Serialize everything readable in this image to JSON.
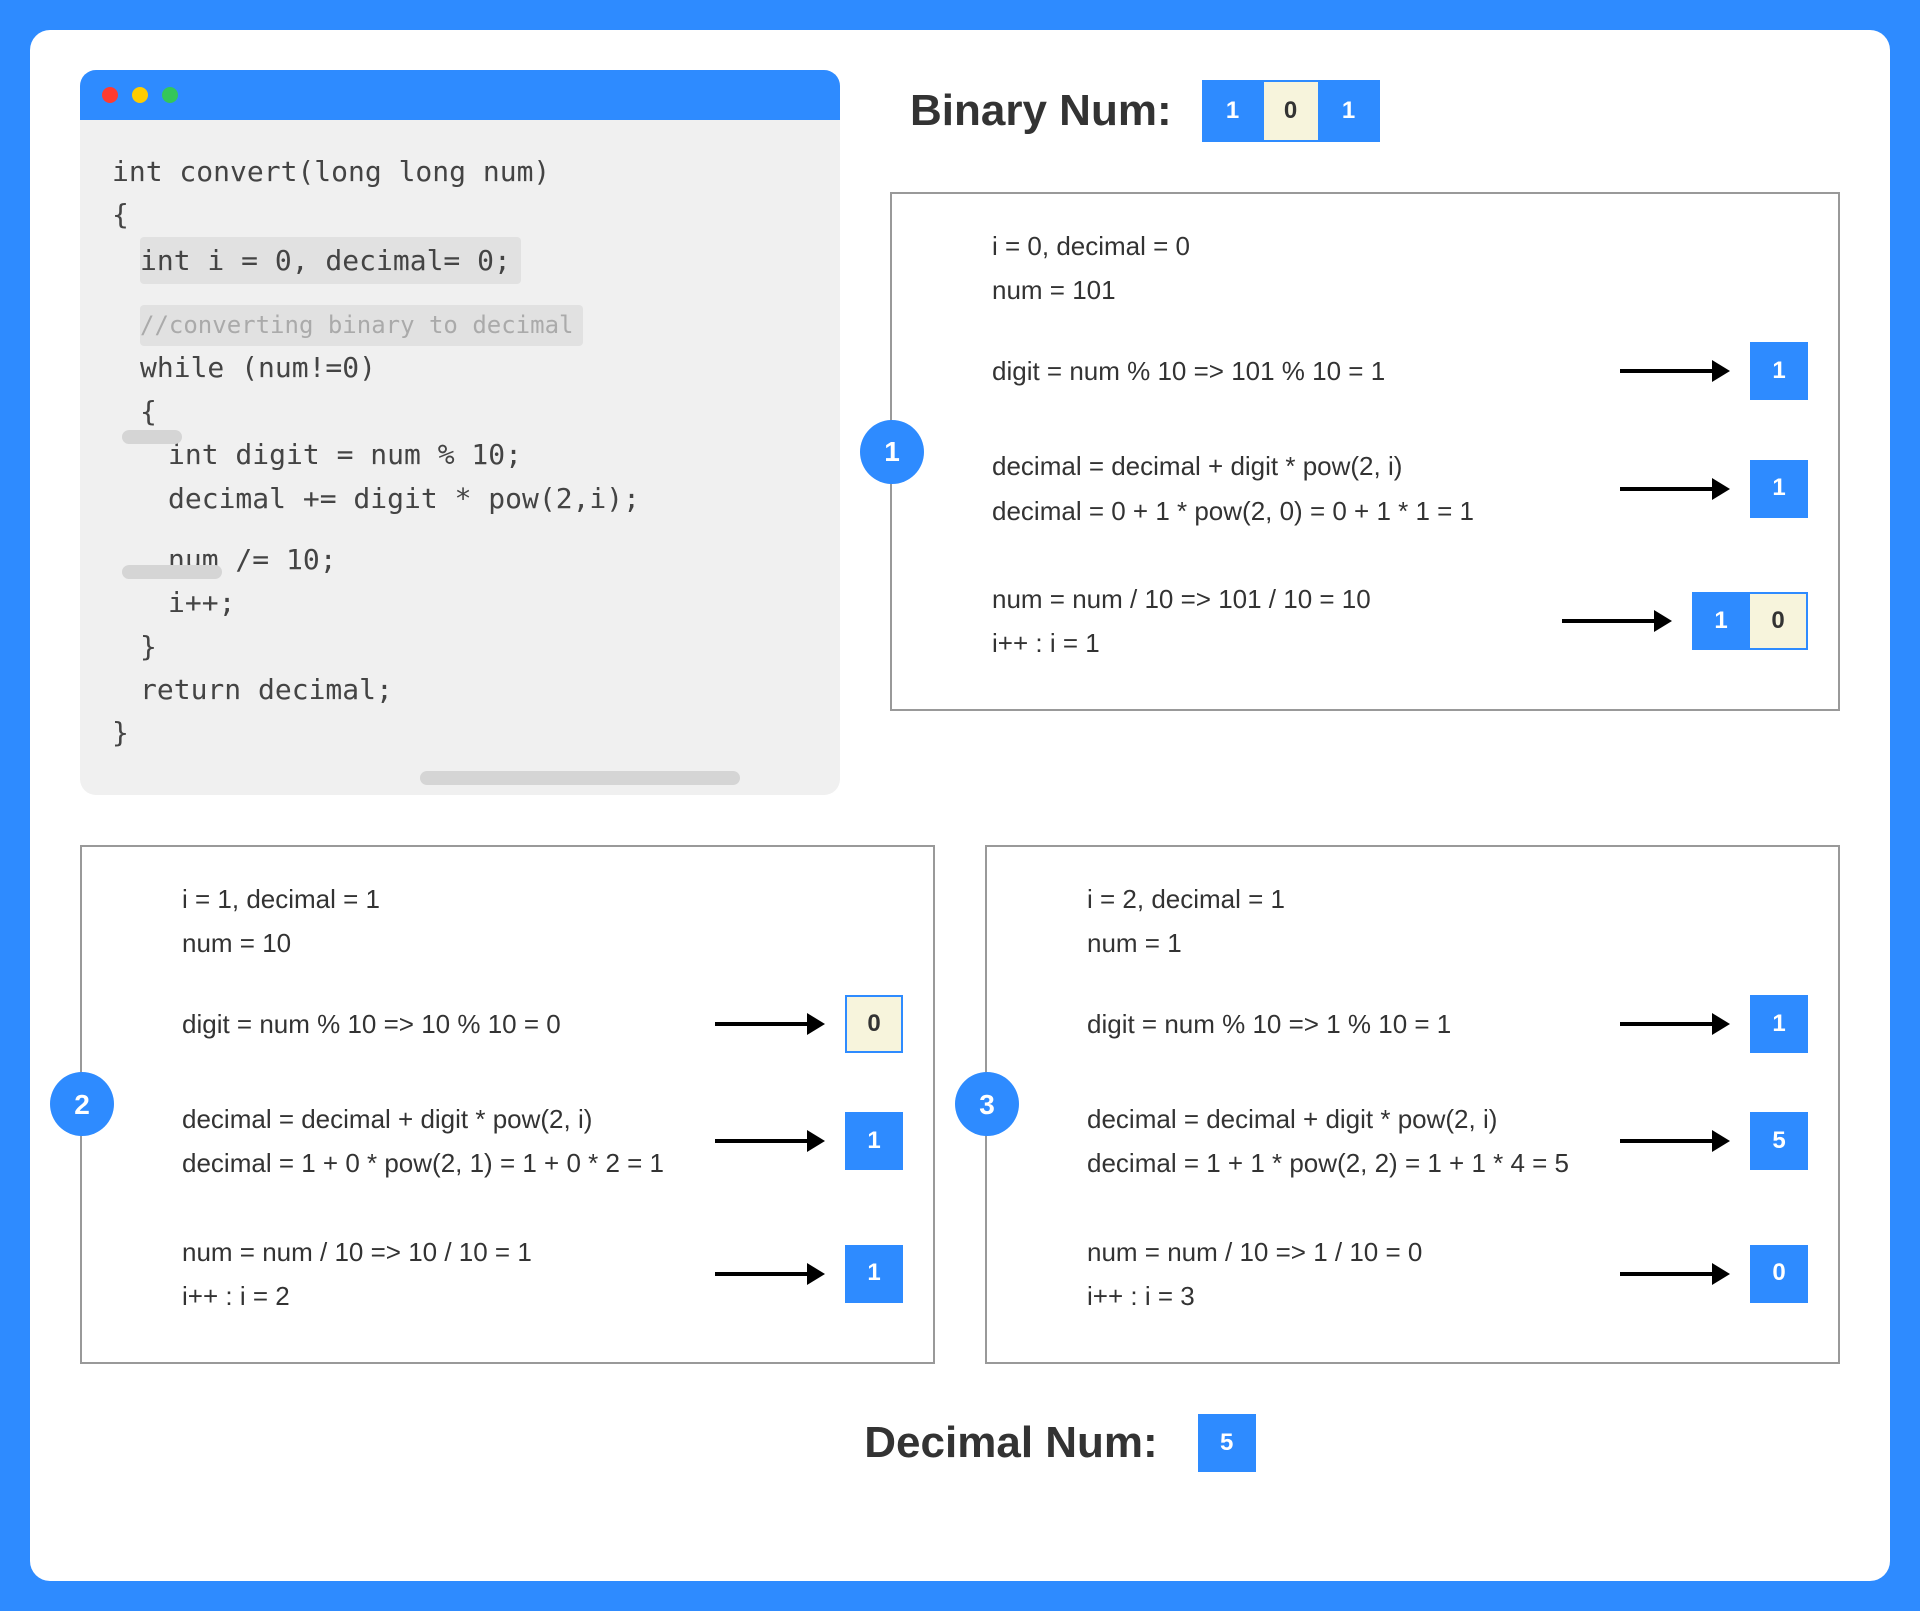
{
  "header": {
    "binary_label": "Binary Num:",
    "binary_digits": [
      "1",
      "0",
      "1"
    ]
  },
  "code": {
    "l1": "int convert(long long num)",
    "l2": "{",
    "l3": "int i = 0, decimal= 0;",
    "l4": "//converting binary to decimal",
    "l5": "while (num!=0)",
    "l6": "{",
    "l7": "int digit = num % 10;",
    "l8": "decimal += digit * pow(2,i);",
    "l9": "num /= 10;",
    "l10": "i++;",
    "l11": "}",
    "l12": "return decimal;",
    "l13": "}"
  },
  "steps": [
    {
      "badge": "1",
      "state": "i = 0, decimal = 0",
      "num": "num = 101",
      "digit": "digit = num % 10 => 101 % 10 = 1",
      "digit_result": "1",
      "digit_result_style": "blue",
      "dec1": "decimal = decimal + digit * pow(2, i)",
      "dec2": "decimal = 0 + 1 * pow(2, 0) = 0 + 1 * 1 = 1",
      "dec_result": "1",
      "num2": "num = num / 10 => 101 / 10 = 10",
      "inc": "i++ : i = 1",
      "num_result_pair": [
        "1",
        "0"
      ]
    },
    {
      "badge": "2",
      "state": "i = 1, decimal = 1",
      "num": "num = 10",
      "digit": "digit = num % 10 => 10 % 10 = 0",
      "digit_result": "0",
      "digit_result_style": "cream",
      "dec1": "decimal = decimal + digit * pow(2, i)",
      "dec2": "decimal = 1 + 0 * pow(2, 1) = 1 + 0 * 2 = 1",
      "dec_result": "1",
      "num2": "num = num / 10 => 10 / 10 = 1",
      "inc": "i++ : i = 2",
      "num_result_single": "1"
    },
    {
      "badge": "3",
      "state": "i = 2, decimal = 1",
      "num": "num = 1",
      "digit": "digit = num % 10 => 1 % 10 = 1",
      "digit_result": "1",
      "digit_result_style": "blue",
      "dec1": "decimal = decimal + digit * pow(2, i)",
      "dec2": "decimal = 1 + 1 * pow(2, 2) = 1 + 1 * 4 = 5",
      "dec_result": "5",
      "num2": "num = num / 10 => 1 / 10 = 0",
      "inc": "i++ : i = 3",
      "num_result_single": "0"
    }
  ],
  "footer": {
    "decimal_label": "Decimal Num:",
    "decimal_value": "5"
  }
}
